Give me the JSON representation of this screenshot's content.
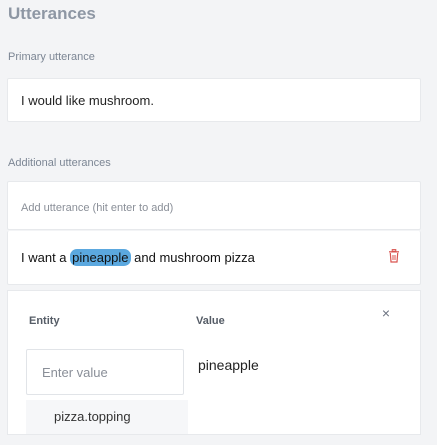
{
  "title": "Utterances",
  "primary": {
    "label": "Primary utterance",
    "value": "I would like mushroom."
  },
  "additional": {
    "label": "Additional utterances",
    "placeholder": "Add utterance (hit enter to add)"
  },
  "utterance": {
    "before": "I want a ",
    "entity": "pineapple",
    "after": " and mushroom pizza",
    "delete_icon": "trash-icon"
  },
  "entity_panel": {
    "entity_header": "Entity",
    "value_header": "Value",
    "close_icon": "×",
    "input_placeholder": "Enter value",
    "value": "pineapple",
    "options": [
      "pizza.topping"
    ]
  },
  "colors": {
    "highlight": "#5ba8df",
    "delete": "#d9534f"
  }
}
